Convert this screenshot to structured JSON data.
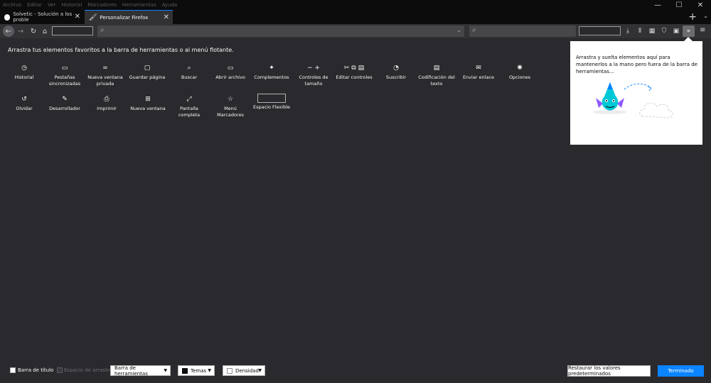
{
  "menubar": {
    "items": [
      "Archivo",
      "Editar",
      "Ver",
      "Historial",
      "Marcadores",
      "Herramientas",
      "Ayuda"
    ],
    "window_controls": [
      "—",
      "☐",
      "✕"
    ]
  },
  "tabs": [
    {
      "title": "Solvetic - Solución a los proble",
      "close": "✕"
    },
    {
      "title": "Personalizar Firefox",
      "close": "✕"
    }
  ],
  "tabstrip": {
    "newtab": "+",
    "list": "⌄"
  },
  "navbar": {
    "back": "←",
    "forward": "→",
    "reload": "↻",
    "home": "⌂",
    "url_icon": "⌕",
    "url_dropdown": "⌄",
    "search_icon": "⌕",
    "icons": [
      "⤓",
      "⫴",
      "▦",
      "⛉",
      "▣",
      "»",
      "≡"
    ]
  },
  "customize": {
    "instructions": "Arrastra tus elementos favoritos a la barra de herramientas o al menú flotante.",
    "items": [
      {
        "icon": "◷",
        "label": "Historial"
      },
      {
        "icon": "▭",
        "label": "Pestañas sincronizadas"
      },
      {
        "icon": "∞",
        "label": "Nueva ventana privada"
      },
      {
        "icon": "▢",
        "label": "Guardar página"
      },
      {
        "icon": "⌕",
        "label": "Buscar"
      },
      {
        "icon": "▭",
        "label": "Abrir archivo"
      },
      {
        "icon": "✦",
        "label": "Complementos"
      },
      {
        "icon": "− +",
        "label": "Controles de tamaño"
      },
      {
        "icon": "✂ ⧉ ▤",
        "label": "Editar controles"
      },
      {
        "icon": "◔",
        "label": "Suscribir"
      },
      {
        "icon": "▤",
        "label": "Codificación del texto"
      },
      {
        "icon": "✉",
        "label": "Enviar enlace"
      },
      {
        "icon": "✺",
        "label": "Opciones"
      },
      {
        "icon": "↺",
        "label": "Olvidar"
      },
      {
        "icon": "✎",
        "label": "Desarrollador"
      },
      {
        "icon": "⎙",
        "label": "Imprimir"
      },
      {
        "icon": "⊞",
        "label": "Nueva ventana"
      },
      {
        "icon": "⤢",
        "label": "Pantalla completa"
      },
      {
        "icon": "☆",
        "label": "Menú Marcadores"
      },
      {
        "icon": "",
        "label": "Espacio Flexible"
      }
    ]
  },
  "overflow_panel": {
    "text": "Arrastra y suelta elementos aquí para mantenerlos a la mano pero fuera de la barra de herramientas..."
  },
  "bottom": {
    "title_bar_label": "Barra de título",
    "drag_space_label": "Espacio de arrastre",
    "toolbars_label": "Barra de herramientas",
    "themes_label": "Temas",
    "density_label": "Densidad",
    "restore_label": "Restaurar los valores predeterminados",
    "done_label": "Terminado"
  },
  "colors": {
    "background": "#2a2a2e",
    "toolbar": "#323234",
    "accent": "#0a84ff",
    "panel": "#ffffff"
  }
}
